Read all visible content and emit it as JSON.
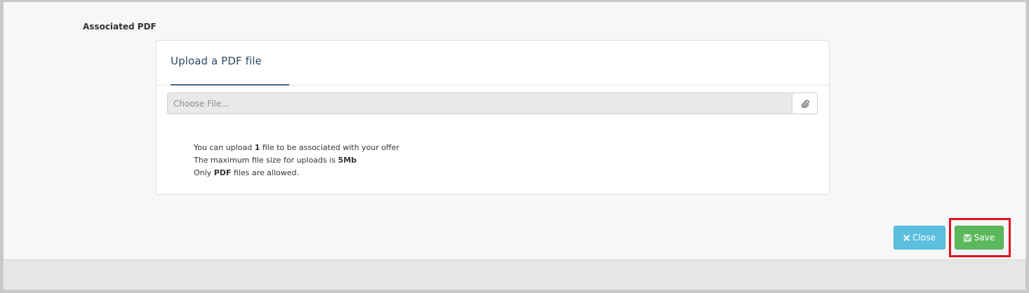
{
  "section": {
    "label": "Associated PDF"
  },
  "upload_panel": {
    "tab_label": "Upload a PDF file",
    "file_input": {
      "placeholder": "Choose File...",
      "value": ""
    },
    "attach_icon": "paperclip-icon",
    "info": {
      "line1_prefix": "You can upload ",
      "line1_count": "1",
      "line1_suffix": " file to be associated with your offer",
      "line2_prefix": "The maximum file size for uploads is ",
      "line2_size": "5Mb",
      "line3_prefix": "Only ",
      "line3_type": "PDF",
      "line3_suffix": " files are allowed."
    }
  },
  "actions": {
    "close_label": "Close",
    "close_icon": "close-icon",
    "save_label": "Save",
    "save_icon": "floppy-disk-icon"
  },
  "colors": {
    "close_button": "#5bc0de",
    "save_button": "#5cb85c",
    "highlight": "#e0101e",
    "tab_title": "#2d4a63"
  }
}
